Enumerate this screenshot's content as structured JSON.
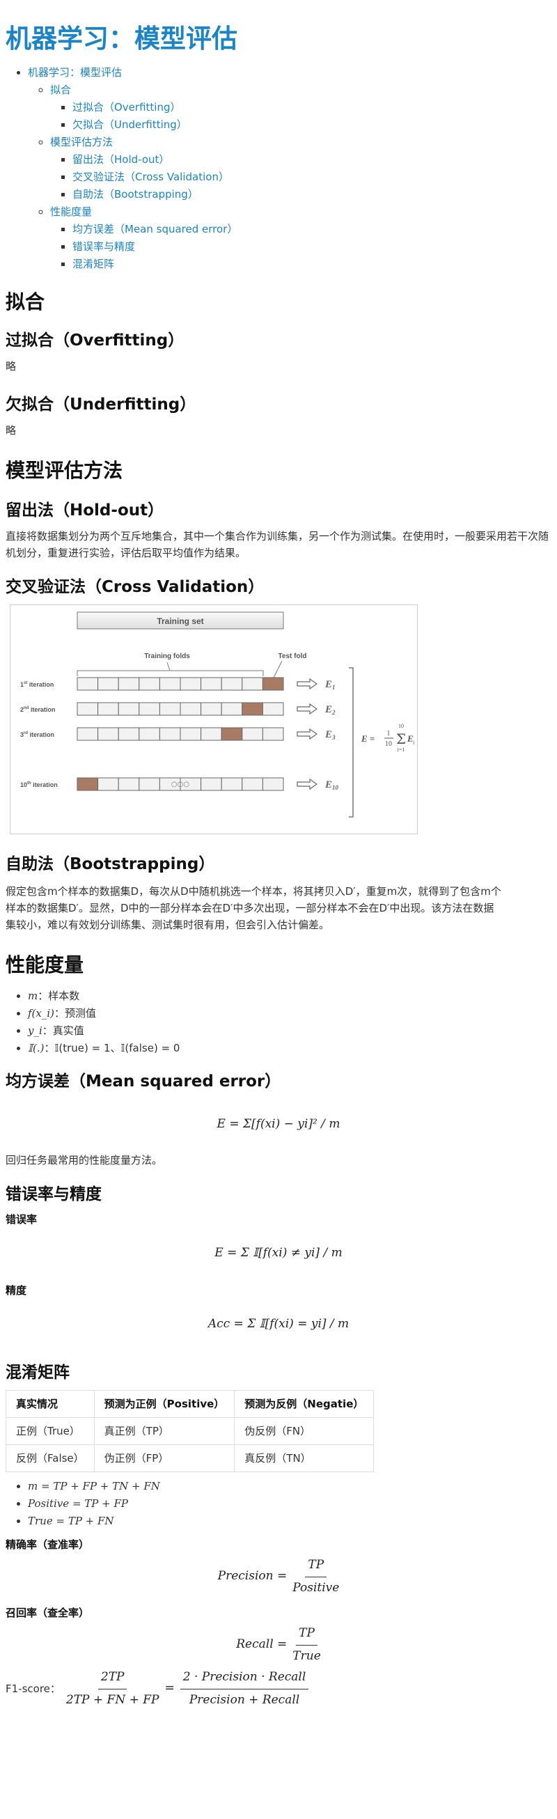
{
  "title": "机器学习：模型评估",
  "toc": {
    "root": "机器学习：模型评估",
    "sections": [
      {
        "label": "拟合",
        "items": [
          "过拟合（Overfitting）",
          "欠拟合（Underfitting）"
        ]
      },
      {
        "label": "模型评估方法",
        "items": [
          "留出法（Hold-out）",
          "交叉验证法（Cross Validation）",
          "自助法（Bootstrapping）"
        ]
      },
      {
        "label": "性能度量",
        "items": [
          "均方误差（Mean squared error）",
          "错误率与精度",
          "混淆矩阵"
        ]
      }
    ]
  },
  "sec_fit": {
    "heading": "拟合",
    "overfit": {
      "heading": "过拟合（Overfitting）",
      "text": "略"
    },
    "underfit": {
      "heading": "欠拟合（Underfitting）",
      "text": "略"
    }
  },
  "sec_eval": {
    "heading": "模型评估方法",
    "holdout": {
      "heading": "留出法（Hold-out）",
      "text": "直接将数据集划分为两个互斥地集合，其中一个集合作为训练集，另一个作为测试集。在使用时，一般要采用若干次随机划分，重复进行实验，评估后取平均值作为结果。"
    },
    "cv": {
      "heading": "交叉验证法（Cross Validation）",
      "figure": {
        "training_set": "Training set",
        "training_folds": "Training folds",
        "test_fold": "Test fold",
        "rows": [
          {
            "label_main": "1",
            "label_sup": "st",
            "label_rest": " iteration",
            "test_index": 9,
            "err": "E",
            "err_sub": "1"
          },
          {
            "label_main": "2",
            "label_sup": "nd",
            "label_rest": " iteration",
            "test_index": 8,
            "err": "E",
            "err_sub": "2"
          },
          {
            "label_main": "3",
            "label_sup": "rd",
            "label_rest": " iteration",
            "test_index": 7,
            "err": "E",
            "err_sub": "3"
          },
          {
            "label_main": "10",
            "label_sup": "th",
            "label_rest": " iteration",
            "test_index": 0,
            "err": "E",
            "err_sub": "10"
          }
        ],
        "dots": "○○○",
        "formula_lhs": "E =",
        "formula_frac_num": "1",
        "formula_frac_den": "10",
        "formula_sum_top": "10",
        "formula_sum_bottom": "i=1",
        "formula_term": "E",
        "formula_term_sub": "i",
        "colors": {
          "test": "#a97b65",
          "fold": "#f2f2f2",
          "border": "#666666"
        }
      }
    },
    "bootstrap": {
      "heading": "自助法（Bootstrapping）",
      "line1": "假定包含m个样本的数据集D，每次从D中随机挑选一个样本，将其拷贝入D′，重复m次，就得到了包含m个",
      "line2": "样本的数据集D′。显然，D中的一部分样本会在D′中多次出现，一部分样本不会在D′中出现。该方法在数据",
      "line3": "集较小，难以有效划分训练集、测试集时很有用，但会引入估计偏差。"
    }
  },
  "sec_perf": {
    "heading": "性能度量",
    "bullets": [
      {
        "math": "m",
        "text": "：样本数"
      },
      {
        "math": "f(x_i)",
        "text": "：预测值"
      },
      {
        "math": "y_i",
        "text": "：真实值"
      },
      {
        "math": "𝕀(.)",
        "text": "：𝕀(true) = 1、𝕀(false) = 0"
      }
    ],
    "mse": {
      "heading": "均方误差（Mean squared error）",
      "formula": "E = Σ[f(xi) − yi]² / m",
      "note": "回归任务最常用的性能度量方法。"
    },
    "err_acc": {
      "heading": "错误率与精度",
      "err_label": "错误率",
      "err_formula": "E = Σ 𝕀[f(xi) ≠ yi] / m",
      "acc_label": "精度",
      "acc_formula": "Acc = Σ 𝕀[f(xi) = yi] / m"
    },
    "cm": {
      "heading": "混淆矩阵",
      "headers": [
        "真实情况",
        "预测为正例（Positive）",
        "预测为反例（Negatie）"
      ],
      "rows": [
        [
          "正例（True）",
          "真正例（TP）",
          "伪反例（FN）"
        ],
        [
          "反例（False）",
          "伪正例（FP）",
          "真反例（TN）"
        ]
      ],
      "identities": [
        "m = TP + FP + TN + FN",
        "Positive = TP + FP",
        "True = TP + FN"
      ],
      "precision_label": "精确率（查准率）",
      "precision_lhs": "Precision =",
      "precision_num": "TP",
      "precision_den": "Positive",
      "recall_label": "召回率（查全率）",
      "recall_lhs": "Recall =",
      "recall_num": "TP",
      "recall_den": "True",
      "f1_label": "F1-score：",
      "f1_num1": "2TP",
      "f1_den1": "2TP + FN + FP",
      "f1_num2": "2 · Precision · Recall",
      "f1_den2": "Precision + Recall"
    }
  }
}
